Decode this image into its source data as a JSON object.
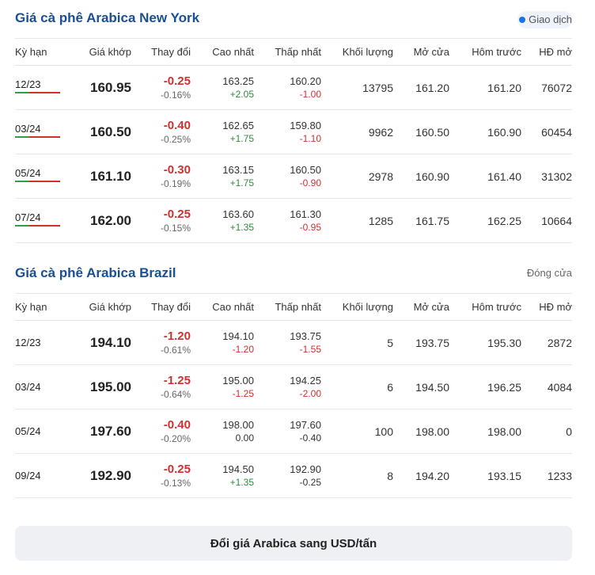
{
  "columns": [
    "Kỳ hạn",
    "Giá khớp",
    "Thay đổi",
    "Cao nhất",
    "Thấp nhất",
    "Khối lượng",
    "Mở cửa",
    "Hôm trước",
    "HĐ mở"
  ],
  "sections": [
    {
      "title": "Giá cà phê Arabica New York",
      "status": "Giao dịch",
      "rows": [
        {
          "term": "12/23",
          "price": "160.95",
          "change": "-0.25",
          "change_pct": "-0.16%",
          "high": "163.25",
          "high_delta": "+2.05",
          "high_dir": "green",
          "low": "160.20",
          "low_delta": "-1.00",
          "low_dir": "red",
          "volume": "13795",
          "open": "161.20",
          "prev": "161.20",
          "oi": "76072"
        },
        {
          "term": "03/24",
          "price": "160.50",
          "change": "-0.40",
          "change_pct": "-0.25%",
          "high": "162.65",
          "high_delta": "+1.75",
          "high_dir": "green",
          "low": "159.80",
          "low_delta": "-1.10",
          "low_dir": "red",
          "volume": "9962",
          "open": "160.50",
          "prev": "160.90",
          "oi": "60454"
        },
        {
          "term": "05/24",
          "price": "161.10",
          "change": "-0.30",
          "change_pct": "-0.19%",
          "high": "163.15",
          "high_delta": "+1.75",
          "high_dir": "green",
          "low": "160.50",
          "low_delta": "-0.90",
          "low_dir": "red",
          "volume": "2978",
          "open": "160.90",
          "prev": "161.40",
          "oi": "31302"
        },
        {
          "term": "07/24",
          "price": "162.00",
          "change": "-0.25",
          "change_pct": "-0.15%",
          "high": "163.60",
          "high_delta": "+1.35",
          "high_dir": "green",
          "low": "161.30",
          "low_delta": "-0.95",
          "low_dir": "red",
          "volume": "1285",
          "open": "161.75",
          "prev": "162.25",
          "oi": "10664"
        }
      ]
    },
    {
      "title": "Giá cà phê Arabica Brazil",
      "status": "Đóng cửa",
      "rows": [
        {
          "term": "12/23",
          "price": "194.10",
          "change": "-1.20",
          "change_pct": "-0.61%",
          "high": "194.10",
          "high_delta": "-1.20",
          "high_dir": "red",
          "low": "193.75",
          "low_delta": "-1.55",
          "low_dir": "red",
          "volume": "5",
          "open": "193.75",
          "prev": "195.30",
          "oi": "2872"
        },
        {
          "term": "03/24",
          "price": "195.00",
          "change": "-1.25",
          "change_pct": "-0.64%",
          "high": "195.00",
          "high_delta": "-1.25",
          "high_dir": "red",
          "low": "194.25",
          "low_delta": "-2.00",
          "low_dir": "red",
          "volume": "6",
          "open": "194.50",
          "prev": "196.25",
          "oi": "4084"
        },
        {
          "term": "05/24",
          "price": "197.60",
          "change": "-0.40",
          "change_pct": "-0.20%",
          "high": "198.00",
          "high_delta": "0.00",
          "high_dir": "neutral",
          "low": "197.60",
          "low_delta": "-0.40",
          "low_dir": "neutral",
          "volume": "100",
          "open": "198.00",
          "prev": "198.00",
          "oi": "0"
        },
        {
          "term": "09/24",
          "price": "192.90",
          "change": "-0.25",
          "change_pct": "-0.13%",
          "high": "194.50",
          "high_delta": "+1.35",
          "high_dir": "green",
          "low": "192.90",
          "low_delta": "-0.25",
          "low_dir": "neutral",
          "volume": "8",
          "open": "194.20",
          "prev": "193.15",
          "oi": "1233"
        }
      ]
    }
  ],
  "convert_button": "Đổi giá Arabica sang USD/tấn",
  "colors": {
    "title": "#1b4f93",
    "down": "#d32f2f",
    "up": "#2e8b3e",
    "live_dot": "#1a73e8"
  }
}
